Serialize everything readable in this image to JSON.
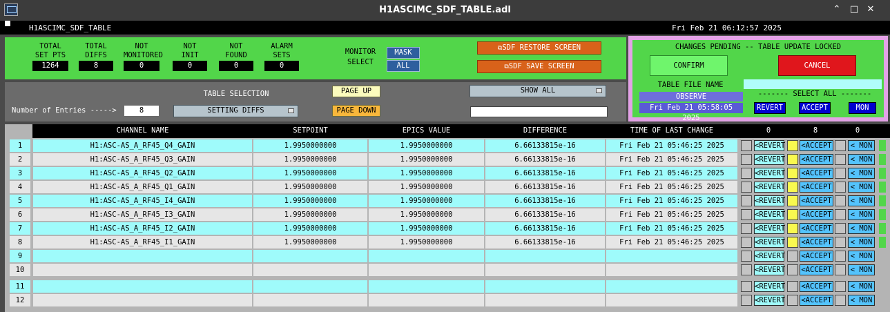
{
  "window": {
    "title": "H1ASCIMC_SDF_TABLE.adl",
    "minimize_glyph": "⌃",
    "maximize_glyph": "□",
    "close_glyph": "✕"
  },
  "infobar": {
    "screen_name": "H1ASCIMC_SDF_TABLE",
    "datetime": "Fri Feb 21 06:12:57 2025"
  },
  "stats": [
    {
      "label_l1": "TOTAL",
      "label_l2": "SET PTS",
      "value": "1264"
    },
    {
      "label_l1": "TOTAL",
      "label_l2": "DIFFS",
      "value": "8"
    },
    {
      "label_l1": "NOT",
      "label_l2": "MONITORED",
      "value": "0"
    },
    {
      "label_l1": "NOT",
      "label_l2": "INIT",
      "value": "0"
    },
    {
      "label_l1": "NOT",
      "label_l2": "FOUND",
      "value": "0"
    },
    {
      "label_l1": "ALARM",
      "label_l2": "SETS",
      "value": "0"
    }
  ],
  "monitor_select": {
    "label_l1": "MONITOR",
    "label_l2": "SELECT",
    "mask": "MASK",
    "all": "ALL"
  },
  "sdf_buttons": {
    "restore": "SDF RESTORE SCREEN",
    "save": "SDF SAVE SCREEN",
    "icon": "⧉"
  },
  "pending": {
    "title": "CHANGES PENDING -- TABLE UPDATE LOCKED",
    "confirm": "CONFIRM",
    "cancel": "CANCEL",
    "table_file_label": "TABLE FILE NAME",
    "observe": "OBSERVE",
    "file_date": "Fri Feb 21 05:58:05 2025",
    "select_all": "------- SELECT ALL -------",
    "revert": "REVERT",
    "accept": "ACCEPT",
    "mon": "MON"
  },
  "selection": {
    "entries_label": "Number of Entries ----->",
    "entries_value": "8",
    "table_selection_label": "TABLE SELECTION",
    "table_selection_value": "SETTING DIFFS",
    "page_up": "PAGE UP",
    "page_down": "PAGE DOWN",
    "show_all": "SHOW ALL"
  },
  "table": {
    "headers": {
      "channel": "CHANNEL NAME",
      "setpoint": "SETPOINT",
      "epics": "EPICS VALUE",
      "difference": "DIFFERENCE",
      "time": "TIME OF LAST CHANGE",
      "count_revert": "0",
      "count_accept": "8",
      "count_mon": "0"
    },
    "action_labels": {
      "revert": "<REVERT",
      "accept": "<ACCEPT",
      "mon": "< MON"
    },
    "rows": [
      {
        "num": "1",
        "channel": "H1:ASC-AS_A_RF45_Q4_GAIN",
        "setpoint": "1.9950000000",
        "epics": "1.9950000000",
        "difference": "6.66133815e-16",
        "time": "Fri Feb 21 05:46:25 2025",
        "accepted": true
      },
      {
        "num": "2",
        "channel": "H1:ASC-AS_A_RF45_Q3_GAIN",
        "setpoint": "1.9950000000",
        "epics": "1.9950000000",
        "difference": "6.66133815e-16",
        "time": "Fri Feb 21 05:46:25 2025",
        "accepted": true
      },
      {
        "num": "3",
        "channel": "H1:ASC-AS_A_RF45_Q2_GAIN",
        "setpoint": "1.9950000000",
        "epics": "1.9950000000",
        "difference": "6.66133815e-16",
        "time": "Fri Feb 21 05:46:25 2025",
        "accepted": true
      },
      {
        "num": "4",
        "channel": "H1:ASC-AS_A_RF45_Q1_GAIN",
        "setpoint": "1.9950000000",
        "epics": "1.9950000000",
        "difference": "6.66133815e-16",
        "time": "Fri Feb 21 05:46:25 2025",
        "accepted": true
      },
      {
        "num": "5",
        "channel": "H1:ASC-AS_A_RF45_I4_GAIN",
        "setpoint": "1.9950000000",
        "epics": "1.9950000000",
        "difference": "6.66133815e-16",
        "time": "Fri Feb 21 05:46:25 2025",
        "accepted": true
      },
      {
        "num": "6",
        "channel": "H1:ASC-AS_A_RF45_I3_GAIN",
        "setpoint": "1.9950000000",
        "epics": "1.9950000000",
        "difference": "6.66133815e-16",
        "time": "Fri Feb 21 05:46:25 2025",
        "accepted": true
      },
      {
        "num": "7",
        "channel": "H1:ASC-AS_A_RF45_I2_GAIN",
        "setpoint": "1.9950000000",
        "epics": "1.9950000000",
        "difference": "6.66133815e-16",
        "time": "Fri Feb 21 05:46:25 2025",
        "accepted": true
      },
      {
        "num": "8",
        "channel": "H1:ASC-AS_A_RF45_I1_GAIN",
        "setpoint": "1.9950000000",
        "epics": "1.9950000000",
        "difference": "6.66133815e-16",
        "time": "Fri Feb 21 05:46:25 2025",
        "accepted": true
      },
      {
        "num": "9",
        "channel": "",
        "setpoint": "",
        "epics": "",
        "difference": "",
        "time": "",
        "accepted": false
      },
      {
        "num": "10",
        "channel": "",
        "setpoint": "",
        "epics": "",
        "difference": "",
        "time": "",
        "accepted": false
      },
      {
        "num": "11",
        "channel": "",
        "setpoint": "",
        "epics": "",
        "difference": "",
        "time": "",
        "accepted": false
      },
      {
        "num": "12",
        "channel": "",
        "setpoint": "",
        "epics": "",
        "difference": "",
        "time": "",
        "accepted": false
      }
    ]
  }
}
